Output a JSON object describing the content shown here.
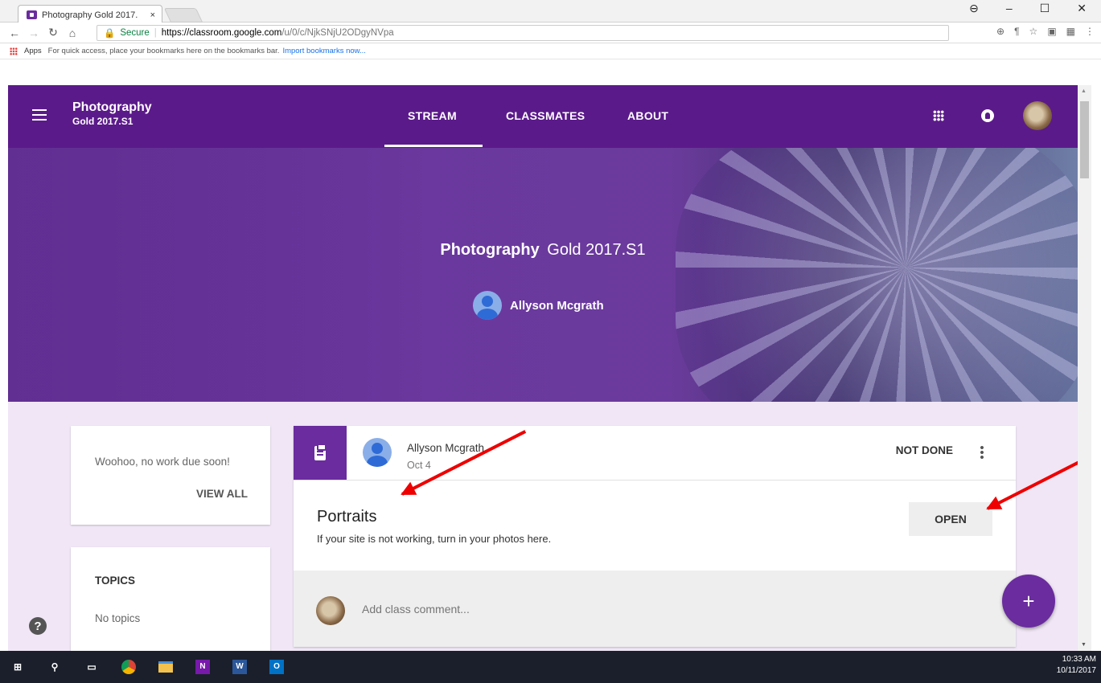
{
  "browser": {
    "tab_title": "Photography Gold 2017.",
    "tab_close": "×",
    "window_buttons": [
      "–",
      "☐",
      "✕"
    ],
    "url_secure_label": "Secure",
    "url_host": "https://classroom.google.com",
    "url_path": "/u/0/c/NjkSNjU2ODgyNVpa",
    "bookmarks_apps": "Apps",
    "bookmarks_hint": "For quick access, place your bookmarks here on the bookmarks bar.",
    "bookmarks_import": "Import bookmarks now..."
  },
  "header": {
    "class_name": "Photography",
    "class_section": "Gold 2017.S1",
    "tabs": [
      {
        "label": "STREAM"
      },
      {
        "label": "CLASSMATES"
      },
      {
        "label": "ABOUT"
      }
    ]
  },
  "banner": {
    "title_bold": "Photography",
    "title_rest": "Gold 2017.S1",
    "teacher": "Allyson Mcgrath"
  },
  "upcoming": {
    "message": "Woohoo, no work due soon!",
    "view_all": "VIEW ALL"
  },
  "topics": {
    "heading": "TOPICS",
    "empty": "No topics"
  },
  "post": {
    "author": "Allyson Mcgrath",
    "date": "Oct 4",
    "status": "NOT DONE",
    "title": "Portraits",
    "description": "If your site is not working, turn in your photos here.",
    "open_label": "OPEN",
    "comment_placeholder": "Add class comment..."
  },
  "help_label": "?",
  "fab_label": "+",
  "taskbar": {
    "time": "10:33 AM",
    "date": "10/11/2017"
  },
  "colors": {
    "theme_purple": "#5b1a8a",
    "accent_purple": "#6a2c9e",
    "annotation_arrow": "#e00000"
  }
}
